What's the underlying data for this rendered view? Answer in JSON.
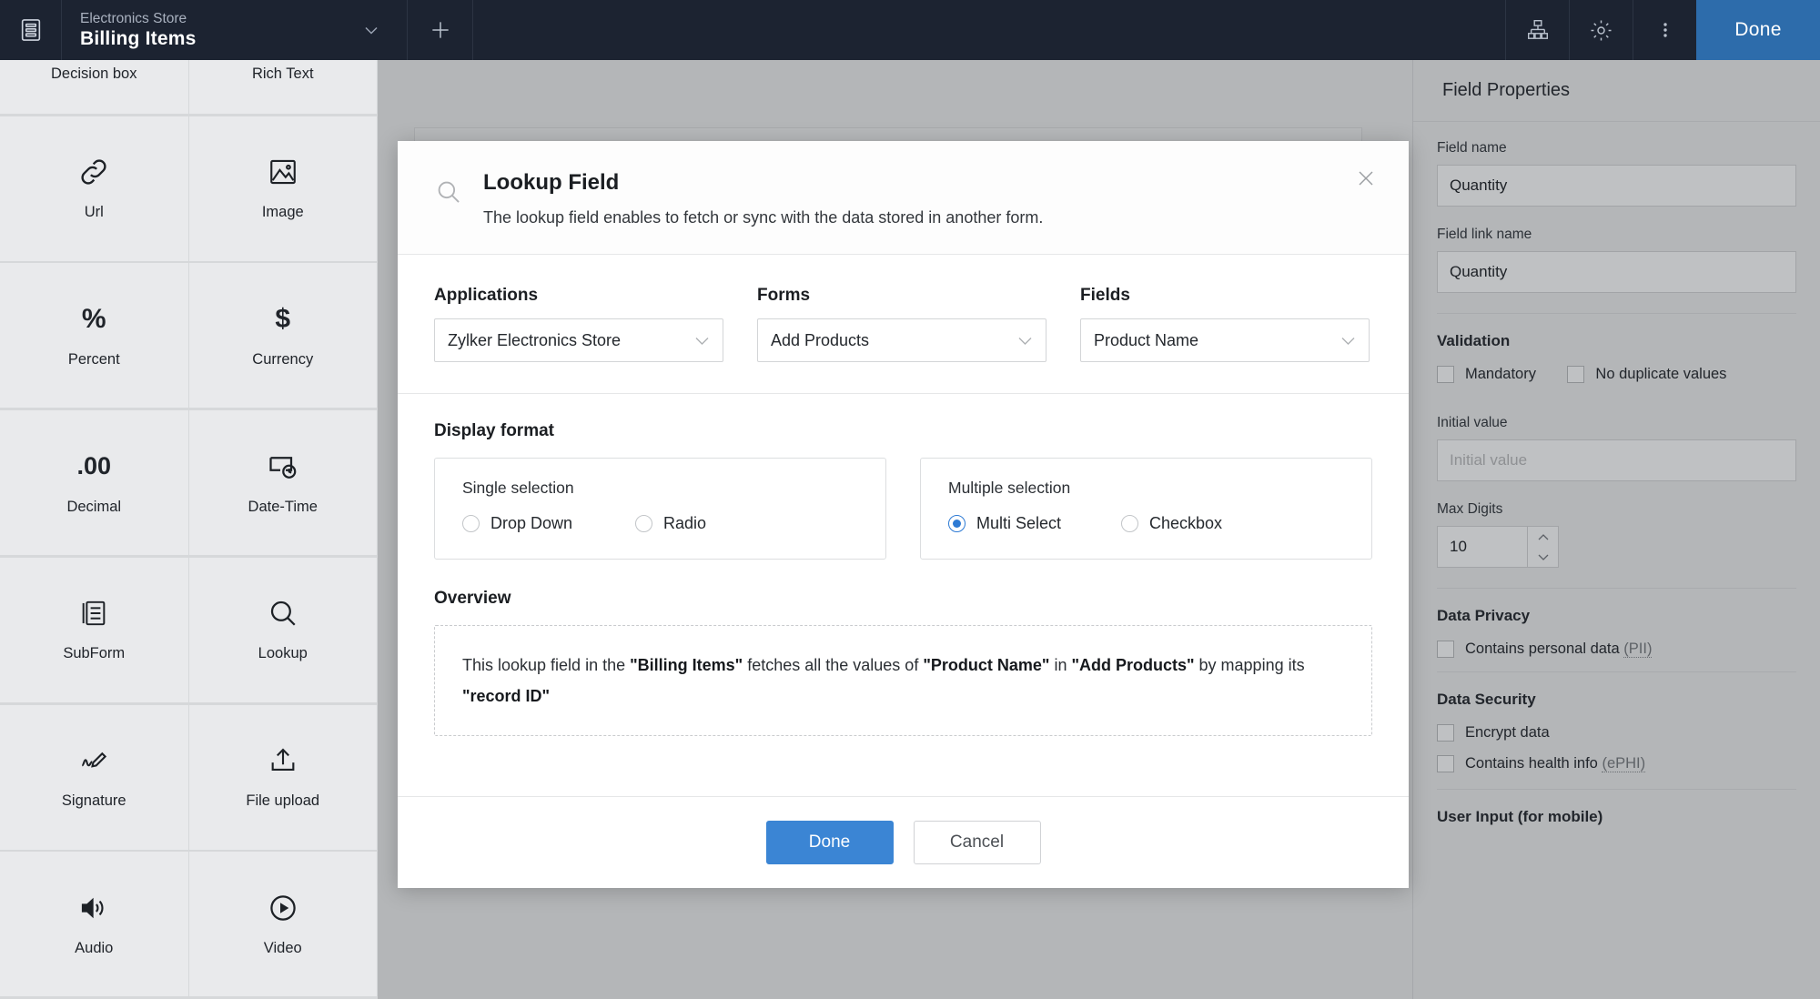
{
  "topbar": {
    "logo_icon": "form-builder-icon",
    "app_name": "Electronics Store",
    "form_name": "Billing Items",
    "chevron_icon": "chevron-down-icon",
    "plus_icon": "plus-icon",
    "hierarchy_icon": "sitemap-icon",
    "settings_icon": "gear-icon",
    "more_icon": "more-vertical-icon",
    "done_label": "Done",
    "accent_color": "#2d6cab",
    "bar_color": "#1c2331"
  },
  "palette": {
    "items": [
      {
        "label": "Decision box",
        "icon": "decision-box-icon",
        "clipped": true
      },
      {
        "label": "Rich Text",
        "icon": "rich-text-icon",
        "clipped": true
      },
      {
        "label": "Url",
        "icon": "link-icon",
        "glyph": ""
      },
      {
        "label": "Image",
        "icon": "image-icon",
        "glyph": ""
      },
      {
        "label": "Percent",
        "icon": "percent-icon",
        "glyph": "%"
      },
      {
        "label": "Currency",
        "icon": "currency-dollar-icon",
        "glyph": "$"
      },
      {
        "label": "Decimal",
        "icon": "decimal-icon",
        "glyph": ".00"
      },
      {
        "label": "Date-Time",
        "icon": "date-time-icon",
        "glyph": ""
      },
      {
        "label": "SubForm",
        "icon": "subform-icon",
        "glyph": ""
      },
      {
        "label": "Lookup",
        "icon": "lookup-magnifier-icon",
        "glyph": ""
      },
      {
        "label": "Signature",
        "icon": "signature-icon",
        "glyph": ""
      },
      {
        "label": "File upload",
        "icon": "upload-icon",
        "glyph": ""
      },
      {
        "label": "Audio",
        "icon": "audio-speaker-icon",
        "glyph": ""
      },
      {
        "label": "Video",
        "icon": "video-play-icon",
        "glyph": ""
      }
    ]
  },
  "properties": {
    "title": "Field Properties",
    "field_name_label": "Field name",
    "field_name_value": "Quantity",
    "field_link_name_label": "Field link name",
    "field_link_name_value": "Quantity",
    "validation_title": "Validation",
    "mandatory_label": "Mandatory",
    "no_duplicate_label": "No duplicate values",
    "initial_value_label": "Initial value",
    "initial_value_placeholder": "Initial value",
    "max_digits_label": "Max Digits",
    "max_digits_value": "10",
    "data_privacy_title": "Data Privacy",
    "personal_data_label": "Contains personal data",
    "personal_data_abbr": "(PII)",
    "data_security_title": "Data Security",
    "encrypt_label": "Encrypt data",
    "health_info_label": "Contains health info",
    "health_info_abbr": "(ePHI)",
    "user_input_title": "User Input (for mobile)"
  },
  "modal": {
    "icon": "lookup-magnifier-icon",
    "title": "Lookup Field",
    "subtitle": "The lookup field enables to fetch or sync with the data stored in another form.",
    "close_icon": "close-icon",
    "selects": [
      {
        "label": "Applications",
        "value": "Zylker Electronics Store",
        "icon": "chevron-down-icon"
      },
      {
        "label": "Forms",
        "value": "Add Products",
        "icon": "chevron-down-icon"
      },
      {
        "label": "Fields",
        "value": "Product Name",
        "icon": "chevron-down-icon"
      }
    ],
    "display_format_title": "Display format",
    "format_cards": [
      {
        "title": "Single selection",
        "options": [
          {
            "label": "Drop Down",
            "selected": false
          },
          {
            "label": "Radio",
            "selected": false
          }
        ]
      },
      {
        "title": "Multiple selection",
        "options": [
          {
            "label": "Multi Select",
            "selected": true
          },
          {
            "label": "Checkbox",
            "selected": false
          }
        ]
      }
    ],
    "overview_title": "Overview",
    "overview": {
      "p1": "This lookup field in the ",
      "b1": "\"Billing Items\"",
      "p2": " fetches all the values of ",
      "b2": "\"Product Name\"",
      "p3": " in ",
      "b3": "\"Add Products\"",
      "p4": " by mapping its ",
      "b4": "\"record ID\""
    },
    "done_label": "Done",
    "cancel_label": "Cancel",
    "primary_color": "#3b85d4"
  }
}
